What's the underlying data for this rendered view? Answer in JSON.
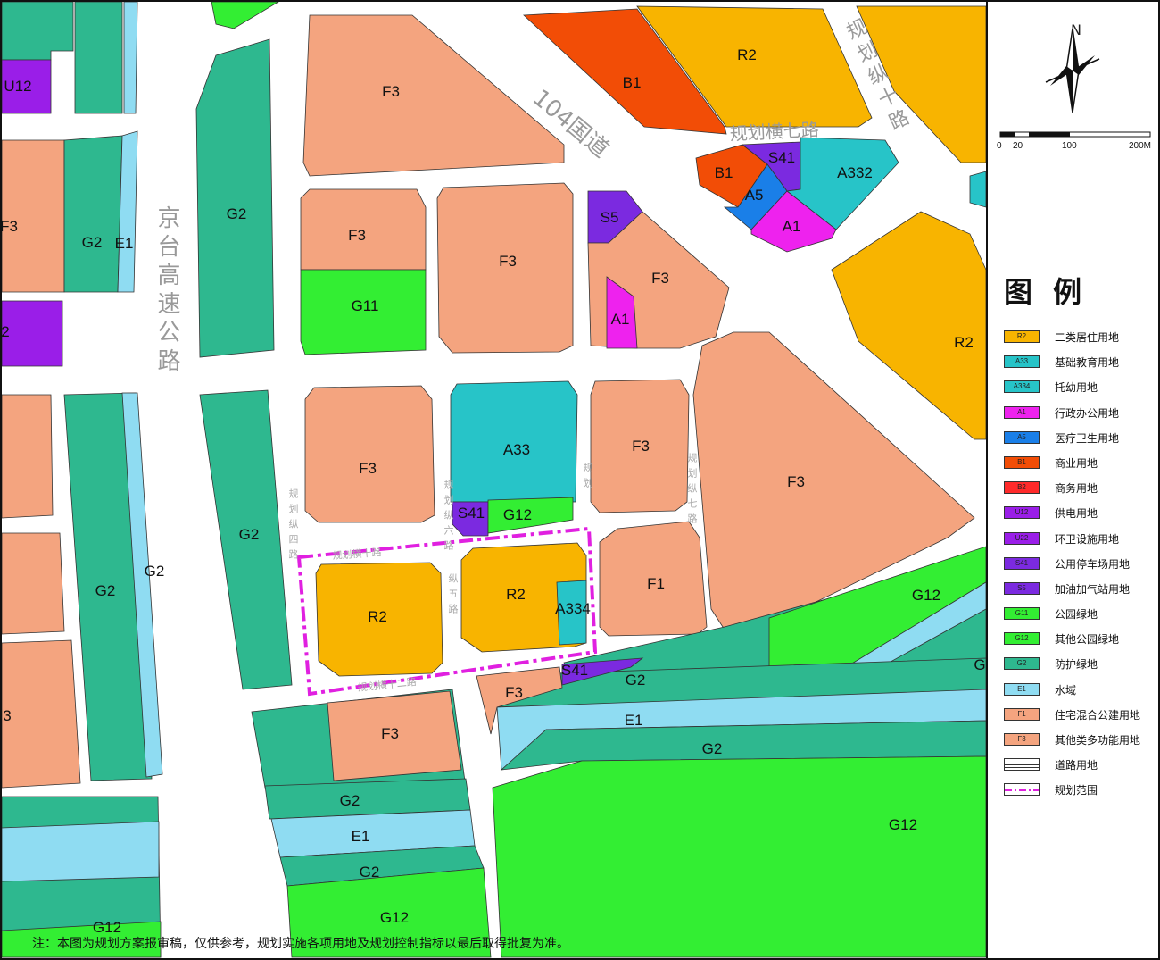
{
  "colors": {
    "R2": "#f8b400",
    "F3": "#f4a47f",
    "F1": "#f4a47f",
    "G2": "#2eb88f",
    "G11": "#33ee33",
    "G12": "#33ee33",
    "E1": "#8fdcf2",
    "A33": "#27c4c8",
    "A334": "#27c4c8",
    "A332": "#27c4c8",
    "A1": "#ee22ee",
    "A5": "#1a7fe8",
    "B1": "#f24d06",
    "S41": "#7b2ae0",
    "S5": "#7b2ae0",
    "U12": "#9a1ee8",
    "boundary": "#e020e0",
    "road": "#ffffff"
  },
  "map": {
    "parcel_labels": {
      "r2_top": "R2",
      "b1_top": "B1",
      "r2_right": "R2",
      "f3_top": "F3",
      "f3_a": "F3",
      "f3_b": "F3",
      "f3_c": "F3",
      "f3_d": "F3",
      "f3_big": "F3",
      "f3_e": "F3",
      "f3_f": "F3",
      "f3_g": "F3",
      "f3_left": "F3",
      "f3_left2": "3",
      "u12_a": "U12",
      "u12_b": "2",
      "g2_a": "G2",
      "g2_b": "G2",
      "g2_c": "G2",
      "g2_d": "G2",
      "g2_e": "G2",
      "g2_f": "G2",
      "g2_g": "G2",
      "g2_h": "G2",
      "g2_i": "G2",
      "g2_j": "G2",
      "g2_k": "G",
      "e1_a": "E1",
      "e1_b": "E1",
      "e1_c": "E1",
      "g11": "G11",
      "g12_a": "G12",
      "g12_b": "G12",
      "g12_c": "G12",
      "g12_d": "G12",
      "g12_e": "G12",
      "a33": "A33",
      "a334": "A334",
      "a332": "A332",
      "s41_a": "S41",
      "s41_b": "S41",
      "s41_c": "S41",
      "s5": "S5",
      "a1_a": "A1",
      "a1_b": "A1",
      "b1_b": "B1",
      "a5": "A5",
      "r2_site_a": "R2",
      "r2_site_b": "R2",
      "f1": "F1"
    },
    "road_labels": {
      "guodao": "104国道",
      "jingtai": "京台高速公路",
      "heng7": "规划横七路",
      "zong10": "规划纵十路"
    },
    "site_road_labels": {
      "zong4": "规划纵四路",
      "heng10": "规划横十路",
      "zong5": "纵五路",
      "heng12": "规划横十二路",
      "zong6": "规划纵六路",
      "zong7": "规划纵七路",
      "zong6b": "规划"
    }
  },
  "compass": {
    "north_label": "N"
  },
  "scale": {
    "ticks": [
      "0",
      "20",
      "100",
      "200M"
    ]
  },
  "legend": {
    "title": "图 例",
    "items": [
      {
        "code": "R2",
        "name": "二类居住用地",
        "color": "#f8b400"
      },
      {
        "code": "A33",
        "name": "基础教育用地",
        "color": "#27c4c8"
      },
      {
        "code": "A334",
        "name": "托幼用地",
        "color": "#27c4c8"
      },
      {
        "code": "A1",
        "name": "行政办公用地",
        "color": "#ee22ee"
      },
      {
        "code": "A5",
        "name": "医疗卫生用地",
        "color": "#1a7fe8"
      },
      {
        "code": "B1",
        "name": "商业用地",
        "color": "#f24d06"
      },
      {
        "code": "B2",
        "name": "商务用地",
        "color": "#ff2a2a"
      },
      {
        "code": "U12",
        "name": "供电用地",
        "color": "#9a1ee8"
      },
      {
        "code": "U22",
        "name": "环卫设施用地",
        "color": "#9a1ee8"
      },
      {
        "code": "S41",
        "name": "公用停车场用地",
        "color": "#7b2ae0"
      },
      {
        "code": "S5",
        "name": "加油加气站用地",
        "color": "#7b2ae0"
      },
      {
        "code": "G11",
        "name": "公园绿地",
        "color": "#33ee33"
      },
      {
        "code": "G12",
        "name": "其他公园绿地",
        "color": "#33ee33"
      },
      {
        "code": "G2",
        "name": "防护绿地",
        "color": "#2eb88f"
      },
      {
        "code": "E1",
        "name": "水域",
        "color": "#8fdcf2"
      },
      {
        "code": "F1",
        "name": "住宅混合公建用地",
        "color": "#f4a47f"
      },
      {
        "code": "F3",
        "name": "其他类多功能用地",
        "color": "#f4a47f"
      },
      {
        "code": "",
        "name": "道路用地",
        "color": "#ffffff"
      },
      {
        "code": "",
        "name": "规划范围",
        "color": "#ffffff"
      }
    ]
  },
  "footnote": "注：本图为规划方案报审稿，仅供参考，规划实施各项用地及规划控制指标以最后取得批复为准。"
}
